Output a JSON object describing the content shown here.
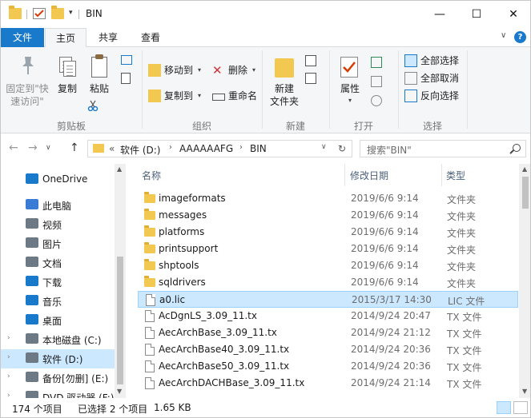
{
  "window": {
    "title": "BIN",
    "controls": {
      "minimize": "—",
      "maximize": "☐",
      "close": "✕"
    }
  },
  "quick_access": {
    "dropdown_arrow": "▾"
  },
  "ribbon_tabs": {
    "file": "文件",
    "home": "主页",
    "share": "共享",
    "view": "查看"
  },
  "ribbon_controls": {
    "collapse": "∨",
    "help": "?"
  },
  "ribbon": {
    "clipboard": {
      "label": "剪贴板",
      "pin": [
        "固定到\"快",
        "速访问\""
      ],
      "copy": "复制",
      "paste": "粘贴"
    },
    "organize": {
      "label": "组织",
      "move_to": "移动到",
      "copy_to": "复制到",
      "delete": "删除",
      "rename": "重命名"
    },
    "new": {
      "label": "新建",
      "new_folder": [
        "新建",
        "文件夹"
      ]
    },
    "open": {
      "label": "打开",
      "properties": "属性"
    },
    "select": {
      "label": "选择",
      "select_all": "全部选择",
      "select_none": "全部取消",
      "invert": "反向选择"
    }
  },
  "address": {
    "back": "←",
    "forward": "→",
    "history": "∨",
    "up": "↑",
    "overflow": "«",
    "segments": [
      "软件 (D:)",
      "AAAAAAFG",
      "BIN"
    ],
    "separator": "›",
    "dropdown": "∨",
    "refresh": "↻",
    "search_placeholder": "搜索\"BIN\""
  },
  "nav_pane": {
    "items": [
      {
        "label": "OneDrive",
        "icon": "cloud-icon",
        "selected": false
      },
      {
        "label": "此电脑",
        "icon": "computer-icon",
        "selected": false
      },
      {
        "label": "视频",
        "icon": "video-icon",
        "selected": false
      },
      {
        "label": "图片",
        "icon": "pictures-icon",
        "selected": false
      },
      {
        "label": "文档",
        "icon": "documents-icon",
        "selected": false
      },
      {
        "label": "下载",
        "icon": "download-icon",
        "selected": false
      },
      {
        "label": "音乐",
        "icon": "music-icon",
        "selected": false
      },
      {
        "label": "桌面",
        "icon": "desktop-icon",
        "selected": false
      },
      {
        "label": "本地磁盘 (C:)",
        "icon": "drive-icon",
        "selected": false
      },
      {
        "label": "软件 (D:)",
        "icon": "drive-icon",
        "selected": true
      },
      {
        "label": "备份[勿删] (E:)",
        "icon": "drive-icon",
        "selected": false
      },
      {
        "label": "DVD 驱动器 (F:)",
        "icon": "dvd-icon",
        "selected": false
      }
    ]
  },
  "columns": {
    "name": "名称",
    "date": "修改日期",
    "type": "类型"
  },
  "files": [
    {
      "name": "imageformats",
      "date": "2019/6/6 9:14",
      "type": "文件夹",
      "kind": "folder",
      "selected": false
    },
    {
      "name": "messages",
      "date": "2019/6/6 9:14",
      "type": "文件夹",
      "kind": "folder",
      "selected": false
    },
    {
      "name": "platforms",
      "date": "2019/6/6 9:14",
      "type": "文件夹",
      "kind": "folder",
      "selected": false
    },
    {
      "name": "printsupport",
      "date": "2019/6/6 9:14",
      "type": "文件夹",
      "kind": "folder",
      "selected": false
    },
    {
      "name": "shptools",
      "date": "2019/6/6 9:14",
      "type": "文件夹",
      "kind": "folder",
      "selected": false
    },
    {
      "name": "sqldrivers",
      "date": "2019/6/6 9:14",
      "type": "文件夹",
      "kind": "folder",
      "selected": false
    },
    {
      "name": "a0.lic",
      "date": "2015/3/17 14:30",
      "type": "LIC 文件",
      "kind": "file",
      "selected": true
    },
    {
      "name": "AcDgnLS_3.09_11.tx",
      "date": "2014/9/24 20:47",
      "type": "TX 文件",
      "kind": "file",
      "selected": false
    },
    {
      "name": "AecArchBase_3.09_11.tx",
      "date": "2014/9/24 21:12",
      "type": "TX 文件",
      "kind": "file",
      "selected": false
    },
    {
      "name": "AecArchBase40_3.09_11.tx",
      "date": "2014/9/24 20:36",
      "type": "TX 文件",
      "kind": "file",
      "selected": false
    },
    {
      "name": "AecArchBase50_3.09_11.tx",
      "date": "2014/9/24 20:36",
      "type": "TX 文件",
      "kind": "file",
      "selected": false
    },
    {
      "name": "AecArchDACHBase_3.09_11.tx",
      "date": "2014/9/24 21:14",
      "type": "TX 文件",
      "kind": "file",
      "selected": false
    }
  ],
  "status": {
    "count": "174 个项目",
    "selected": "已选择 2 个项目",
    "size": "1.65 KB"
  },
  "colors": {
    "accent": "#1979ca",
    "selection": "#cce8ff",
    "folder": "#f3c850"
  }
}
